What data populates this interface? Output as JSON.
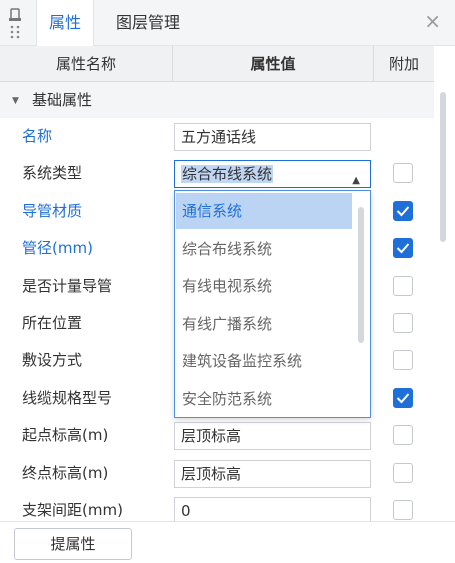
{
  "tabs": [
    {
      "label": "属性",
      "active": true
    },
    {
      "label": "图层管理",
      "active": false
    }
  ],
  "close_glyph": "×",
  "table": {
    "headers": [
      "属性名称",
      "属性值",
      "附加"
    ],
    "group_label": "基础属性",
    "rows": [
      {
        "name": "名称",
        "blue": true,
        "value": "五方通话线",
        "checkbox": null
      },
      {
        "name": "系统类型",
        "blue": false,
        "value": "综合布线系统",
        "checkbox": false
      },
      {
        "name": "导管材质",
        "blue": true,
        "value": "",
        "checkbox": true
      },
      {
        "name": "管径(mm)",
        "blue": true,
        "value": "",
        "checkbox": true
      },
      {
        "name": "是否计量导管",
        "blue": false,
        "value": "",
        "checkbox": false
      },
      {
        "name": "所在位置",
        "blue": false,
        "value": "",
        "checkbox": false
      },
      {
        "name": "敷设方式",
        "blue": false,
        "value": "",
        "checkbox": false
      },
      {
        "name": "线缆规格型号",
        "blue": false,
        "value": "",
        "checkbox": true
      },
      {
        "name": "起点标高(m)",
        "blue": false,
        "value": "层顶标高",
        "checkbox": false
      },
      {
        "name": "终点标高(m)",
        "blue": false,
        "value": "层顶标高",
        "checkbox": false
      },
      {
        "name": "支架间距(mm)",
        "blue": false,
        "value": "0",
        "checkbox": false
      }
    ]
  },
  "dropdown": {
    "options": [
      "通信系统",
      "综合布线系统",
      "有线电视系统",
      "有线广播系统",
      "建筑设备监控系统",
      "安全防范系统"
    ],
    "highlighted_index": 0
  },
  "footer": {
    "button_label": "提属性"
  },
  "colors": {
    "accent": "#1f6fd9",
    "highlight": "#bcd4f3"
  }
}
